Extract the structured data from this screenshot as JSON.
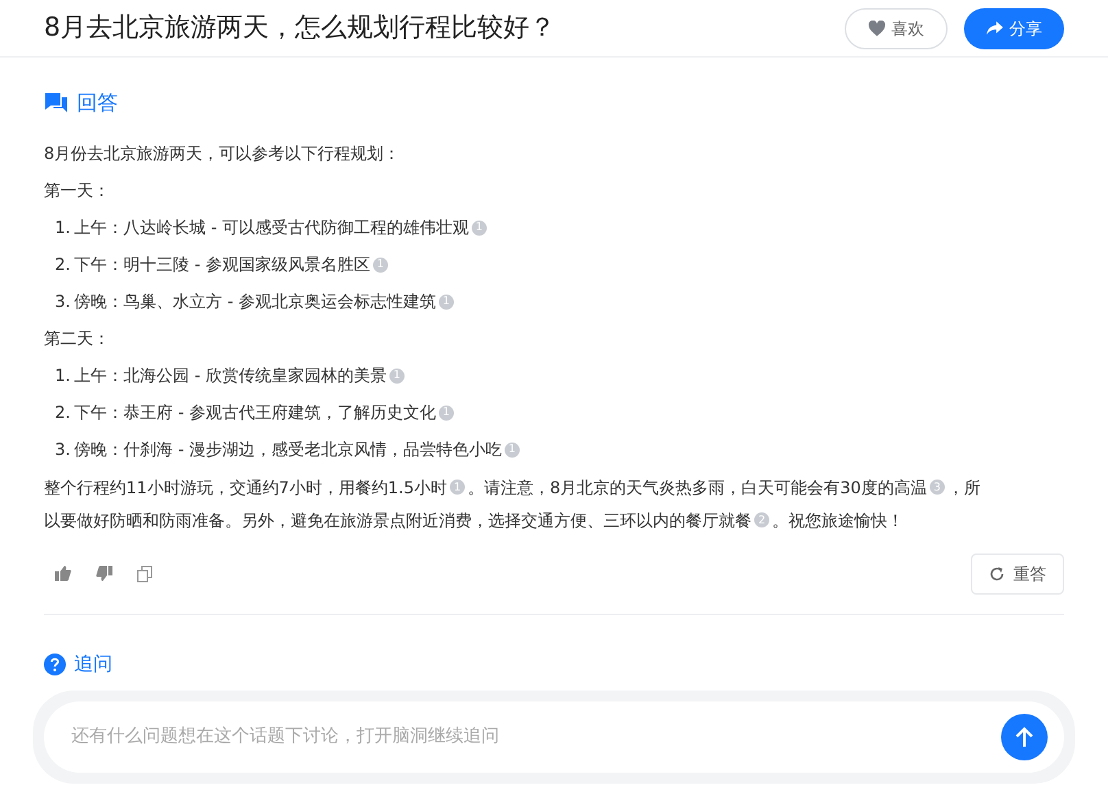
{
  "header": {
    "title": "8月去北京旅游两天，怎么规划行程比较好？",
    "like_button": "喜欢",
    "share_button": "分享"
  },
  "answer": {
    "heading": "回答",
    "intro": "8月份去北京旅游两天，可以参考以下行程规划：",
    "days": [
      {
        "label": "第一天：",
        "items": [
          {
            "number": "1.",
            "text": "上午：八达岭长城 - 可以感受古代防御工程的雄伟壮观",
            "cite": "1"
          },
          {
            "number": "2.",
            "text": "下午：明十三陵 - 参观国家级风景名胜区",
            "cite": "1"
          },
          {
            "number": "3.",
            "text": "傍晚：鸟巢、水立方 - 参观北京奥运会标志性建筑",
            "cite": "1"
          }
        ]
      },
      {
        "label": "第二天：",
        "items": [
          {
            "number": "1.",
            "text": "上午：北海公园 - 欣赏传统皇家园林的美景",
            "cite": "1"
          },
          {
            "number": "2.",
            "text": "下午：恭王府 - 参观古代王府建筑，了解历史文化",
            "cite": "1"
          },
          {
            "number": "3.",
            "text": "傍晚：什刹海 - 漫步湖边，感受老北京风情，品尝特色小吃",
            "cite": "1"
          }
        ]
      }
    ],
    "summary_lines": [
      [
        {
          "kind": "text",
          "text": "整个行程约11小时游玩，交通约7小时，用餐约1.5小时"
        },
        {
          "kind": "cite",
          "text": "1"
        },
        {
          "kind": "text",
          "text": "。请注意，8月北京的天气炎热多雨，白天可能会有30度的高温"
        },
        {
          "kind": "cite",
          "text": "3"
        },
        {
          "kind": "text",
          "text": "，所"
        }
      ],
      [
        {
          "kind": "text",
          "text": "以要做好防晒和防雨准备。另外，避免在旅游景点附近消费，选择交通方便、三环以内的餐厅就餐"
        },
        {
          "kind": "cite",
          "text": "2"
        },
        {
          "kind": "text",
          "text": "。祝您旅途愉快！"
        }
      ]
    ],
    "regenerate_button": "重答"
  },
  "follow_up": {
    "heading": "追问",
    "placeholder": "还有什么问题想在这个话题下讨论，打开脑洞继续追问"
  }
}
